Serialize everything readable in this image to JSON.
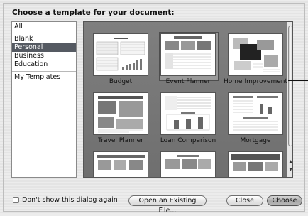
{
  "dialog": {
    "title": "Choose a template for your document:"
  },
  "categories": [
    {
      "label": "All",
      "selected": false
    },
    {
      "label": "Blank",
      "selected": false
    },
    {
      "label": "Personal",
      "selected": true
    },
    {
      "label": "Business",
      "selected": false
    },
    {
      "label": "Education",
      "selected": false
    },
    {
      "label": "My Templates",
      "selected": false
    }
  ],
  "templates": [
    {
      "label": "Budget",
      "selected": false
    },
    {
      "label": "Event Planner",
      "selected": true
    },
    {
      "label": "Home Improvement",
      "selected": false
    },
    {
      "label": "Travel Planner",
      "selected": false
    },
    {
      "label": "Loan Comparison",
      "selected": false
    },
    {
      "label": "Mortgage",
      "selected": false
    },
    {
      "label": "",
      "selected": false
    },
    {
      "label": "",
      "selected": false
    },
    {
      "label": "",
      "selected": false
    }
  ],
  "footer": {
    "checkbox_label": "Don't show this dialog again",
    "checkbox_checked": false,
    "open_existing_label": "Open an Existing File...",
    "close_label": "Close",
    "choose_label": "Choose"
  },
  "scrollbar": {
    "up_icon": "triangle-up",
    "down_icon": "triangle-down"
  }
}
